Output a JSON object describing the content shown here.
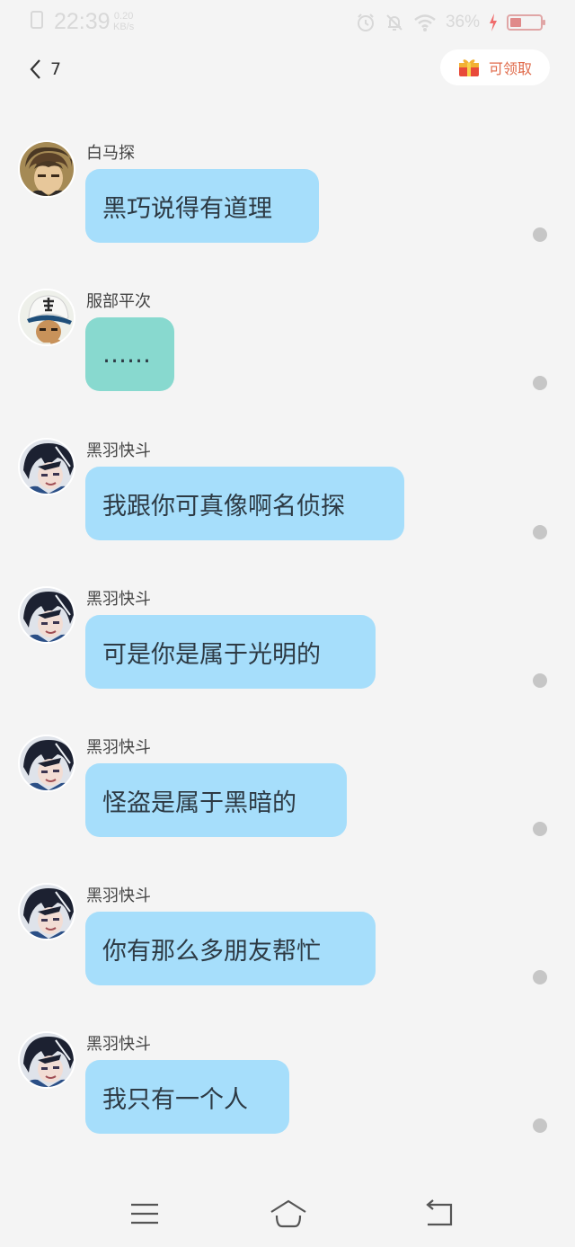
{
  "status_bar": {
    "time": "22:39",
    "net_speed_value": "0.20",
    "net_speed_unit": "KB/s",
    "battery_percent": "36%",
    "battery_level": 0.36,
    "icons": [
      "sim-icon",
      "alarm-icon",
      "mute-icon",
      "wifi-icon",
      "charging-icon",
      "battery-icon"
    ]
  },
  "header": {
    "back_count": "7",
    "claim_label": "可领取",
    "accent_color": "#e06a4a"
  },
  "messages": [
    {
      "sender": "白马探",
      "text": "黑巧说得有道理",
      "bubble_color": "#a6defb",
      "avatar": "avatar-hakuba"
    },
    {
      "sender": "服部平次",
      "text": "……",
      "bubble_color": "#88d9cf",
      "avatar": "avatar-hattori"
    },
    {
      "sender": "黑羽快斗",
      "text": "我跟你可真像啊名侦探",
      "bubble_color": "#a6defb",
      "avatar": "avatar-kaito"
    },
    {
      "sender": "黑羽快斗",
      "text": "可是你是属于光明的",
      "bubble_color": "#a6defb",
      "avatar": "avatar-kaito"
    },
    {
      "sender": "黑羽快斗",
      "text": "怪盗是属于黑暗的",
      "bubble_color": "#a6defb",
      "avatar": "avatar-kaito"
    },
    {
      "sender": "黑羽快斗",
      "text": "你有那么多朋友帮忙",
      "bubble_color": "#a6defb",
      "avatar": "avatar-kaito"
    },
    {
      "sender": "黑羽快斗",
      "text": "我只有一个人",
      "bubble_color": "#a6defb",
      "avatar": "avatar-kaito"
    }
  ],
  "nav_bar": {
    "icons": [
      "menu-icon",
      "home-icon",
      "back-nav-icon"
    ]
  }
}
